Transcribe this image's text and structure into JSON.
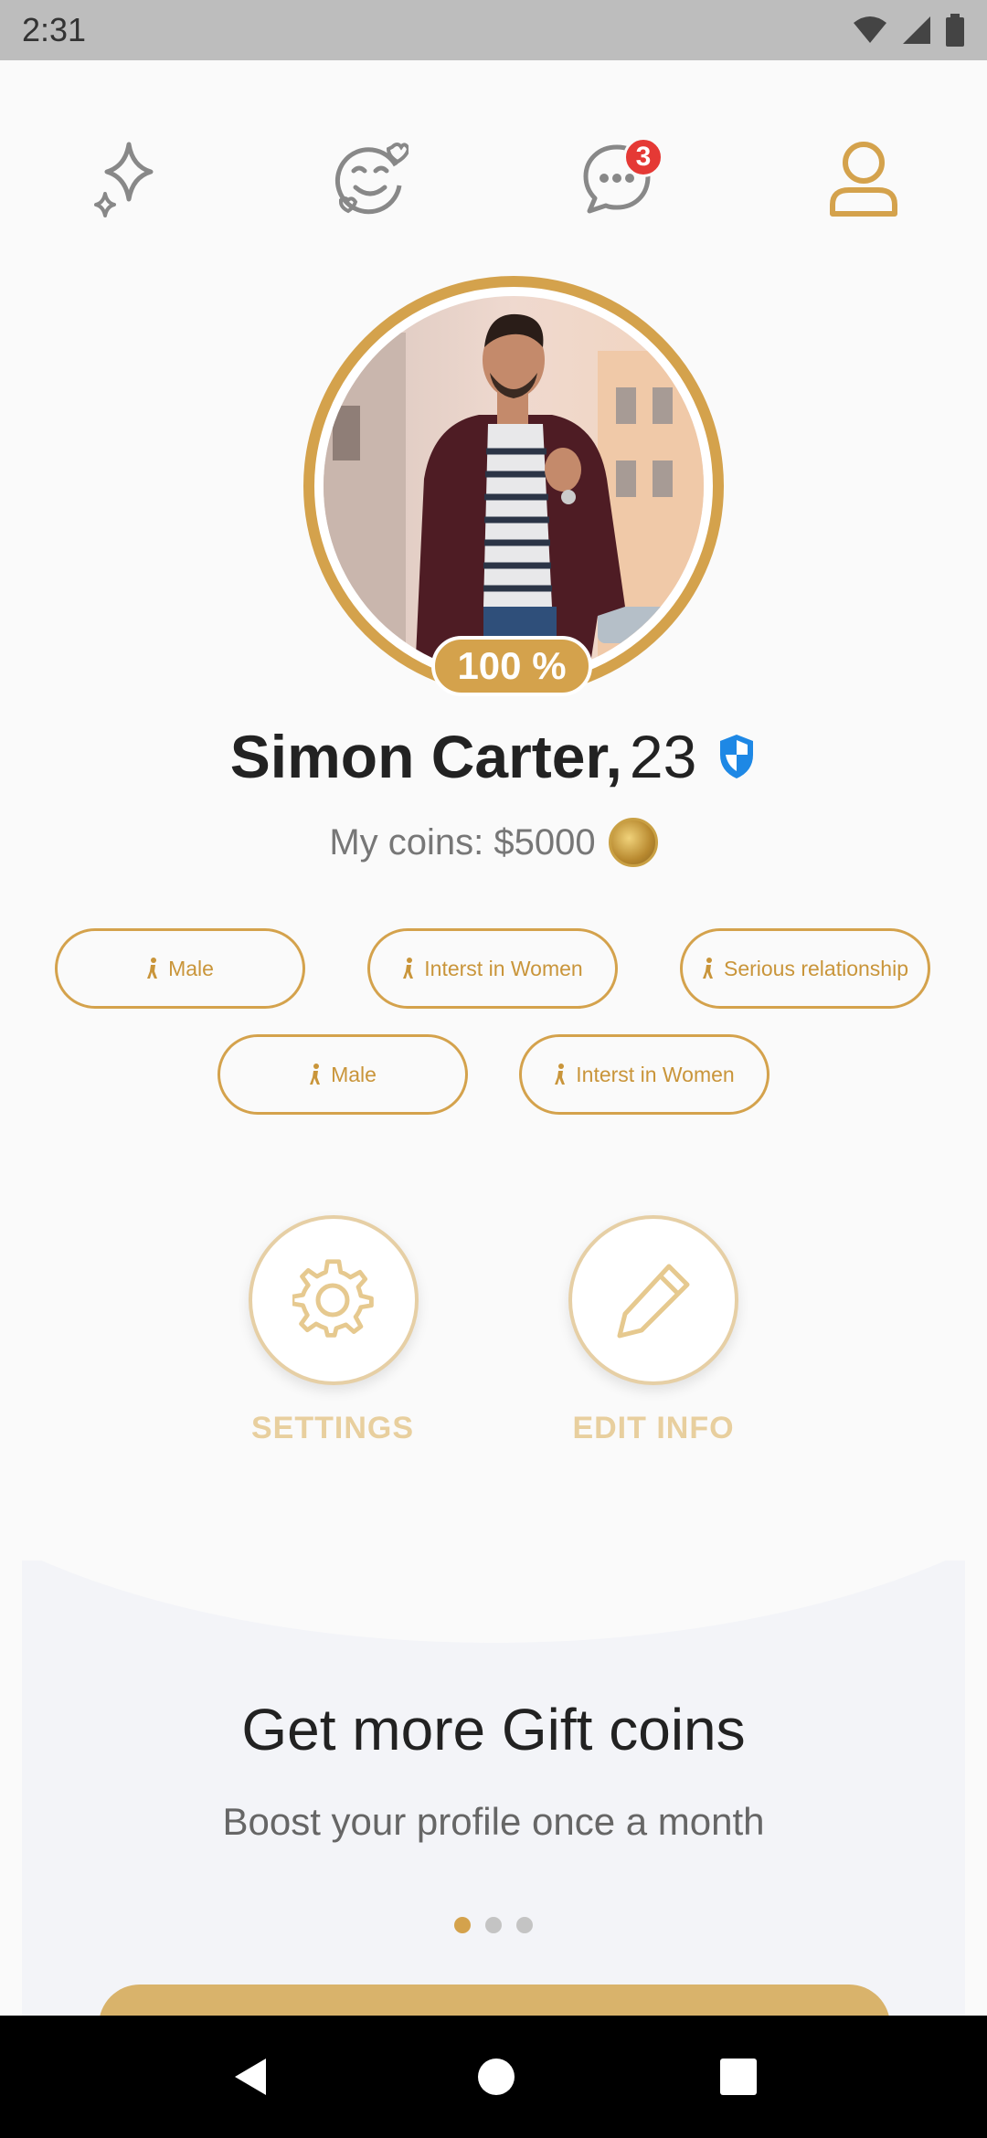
{
  "status_bar": {
    "time": "2:31"
  },
  "nav": {
    "discover_icon": "sparkle-icon",
    "matches_icon": "love-face-icon",
    "messages_icon": "chat-bubble-icon",
    "messages_badge": "3",
    "profile_icon": "person-icon"
  },
  "profile": {
    "completion": "100 %",
    "name": "Simon Carter,",
    "age": "23",
    "coins_label": "My coins: $5000",
    "tags": [
      {
        "label": "Male"
      },
      {
        "label": "Interst in Women"
      },
      {
        "label": "Serious relationship"
      },
      {
        "label": "Male"
      },
      {
        "label": "Interst in Women"
      }
    ]
  },
  "actions": {
    "settings_label": "SETTINGS",
    "edit_label": "EDIT INFO"
  },
  "promo": {
    "title": "Get more Gift coins",
    "subtitle": "Boost your profile once a month",
    "active_dot": 1,
    "dot_count": 3
  },
  "colors": {
    "accent": "#d4a24c",
    "badge": "#e53935",
    "verified": "#1e88e5"
  }
}
